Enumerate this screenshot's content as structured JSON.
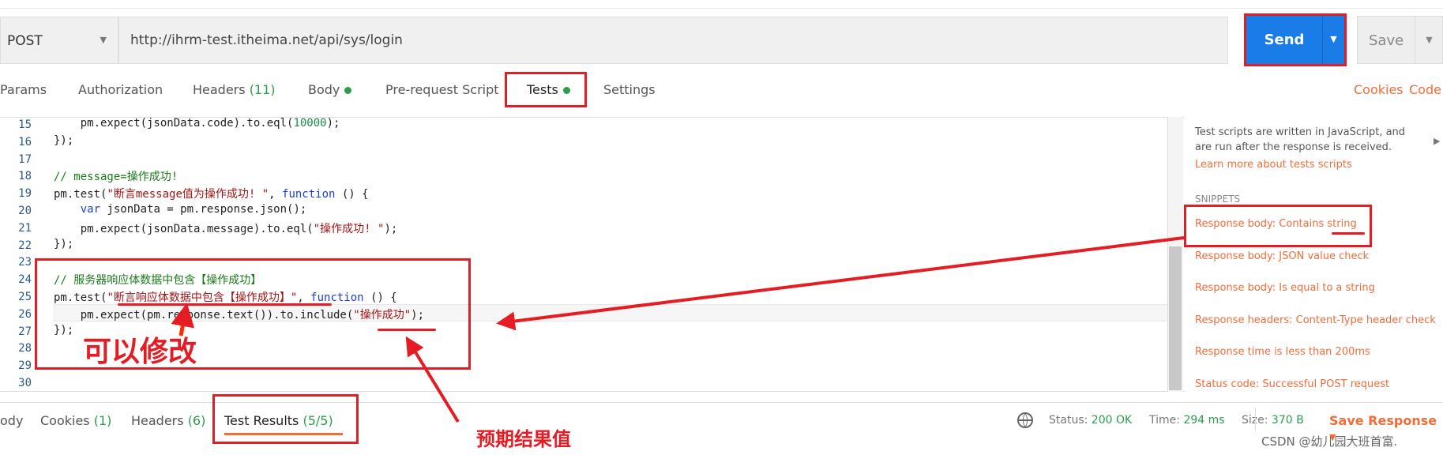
{
  "request": {
    "method": "POST",
    "url": "http://ihrm-test.itheima.net/api/sys/login",
    "send_label": "Send",
    "save_label": "Save"
  },
  "tabs": [
    {
      "label": "Params"
    },
    {
      "label": "Authorization"
    },
    {
      "label": "Headers",
      "count": "(11)"
    },
    {
      "label": "Body"
    },
    {
      "label": "Pre-request Script"
    },
    {
      "label": "Tests"
    },
    {
      "label": "Settings"
    }
  ],
  "links": {
    "cookies": "Cookies",
    "code": "Code"
  },
  "editor": {
    "lines": [
      {
        "n": "15"
      },
      {
        "n": "16"
      },
      {
        "n": "17"
      },
      {
        "n": "18"
      },
      {
        "n": "19"
      },
      {
        "n": "20"
      },
      {
        "n": "21"
      },
      {
        "n": "22"
      },
      {
        "n": "23"
      },
      {
        "n": "24"
      },
      {
        "n": "25"
      },
      {
        "n": "26"
      },
      {
        "n": "27"
      },
      {
        "n": "28"
      },
      {
        "n": "29"
      },
      {
        "n": "30"
      }
    ],
    "code": {
      "l15a": "    pm.expect(jsonData.code).to.eql(",
      "l15b": "10000",
      "l15c": ");",
      "l16": "});",
      "l18": "// message=操作成功!",
      "l19a": "pm.test(",
      "l19b": "\"断言message值为操作成功! \"",
      "l19c": ", ",
      "l19d": "function",
      "l19e": " () {",
      "l20a": "    ",
      "l20b": "var",
      "l20c": " jsonData = pm.response.json();",
      "l21a": "    pm.expect(jsonData.message).to.eql(",
      "l21b": "\"操作成功! \"",
      "l21c": ");",
      "l22": "});",
      "l24": "// 服务器响应体数据中包含【操作成功】",
      "l25a": "pm.test(",
      "l25b": "\"断言响应体数据中包含【操作成功】\"",
      "l25c": ", ",
      "l25d": "function",
      "l25e": " () {",
      "l26a": "    pm.expect(pm.response.text()).to.include(",
      "l26b": "\"操作成功\"",
      "l26c": ");",
      "l27": "});"
    }
  },
  "sidebar": {
    "description": "Test scripts are written in JavaScript, and are run after the response is received.",
    "learn_more": "Learn more about tests scripts",
    "snippets_heading": "SNIPPETS",
    "snippets": [
      "Response body: Contains string",
      "Response body: JSON value check",
      "Response body: Is equal to a string",
      "Response headers: Content-Type header check",
      "Response time is less than 200ms",
      "Status code: Successful POST request"
    ]
  },
  "response": {
    "tabs": [
      {
        "label": "ody"
      },
      {
        "label": "Cookies",
        "count": "(1)"
      },
      {
        "label": "Headers",
        "count": "(6)"
      },
      {
        "label": "Test Results",
        "count": "(5/5)"
      }
    ],
    "status_label": "Status:",
    "status": "200 OK",
    "time_label": "Time:",
    "time": "294 ms",
    "size_label": "Size:",
    "size": "370 B",
    "save_response": "Save Response"
  },
  "annotations": {
    "can_modify": "可以修改",
    "expected_value": "预期结果值",
    "annotation_color": "#e51c23"
  },
  "watermark": "CSDN @幼儿园大班首富.",
  "colors": {
    "accent": "#f06d3a",
    "send": "#1a7ce6",
    "success": "#2d9c4d"
  }
}
